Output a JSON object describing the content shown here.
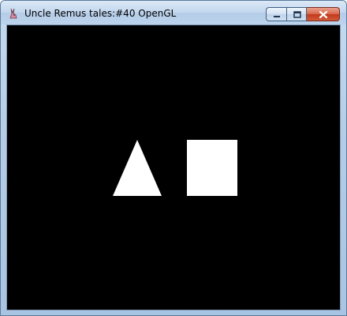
{
  "window": {
    "title": "Uncle Remus tales:#40 OpenGL",
    "icon": "rabbit-app-icon",
    "buttons": [
      "minimize",
      "maximize",
      "close"
    ]
  },
  "scene": {
    "background_color": "#000000",
    "shape_color": "#ffffff",
    "shapes": [
      "triangle",
      "square"
    ]
  }
}
